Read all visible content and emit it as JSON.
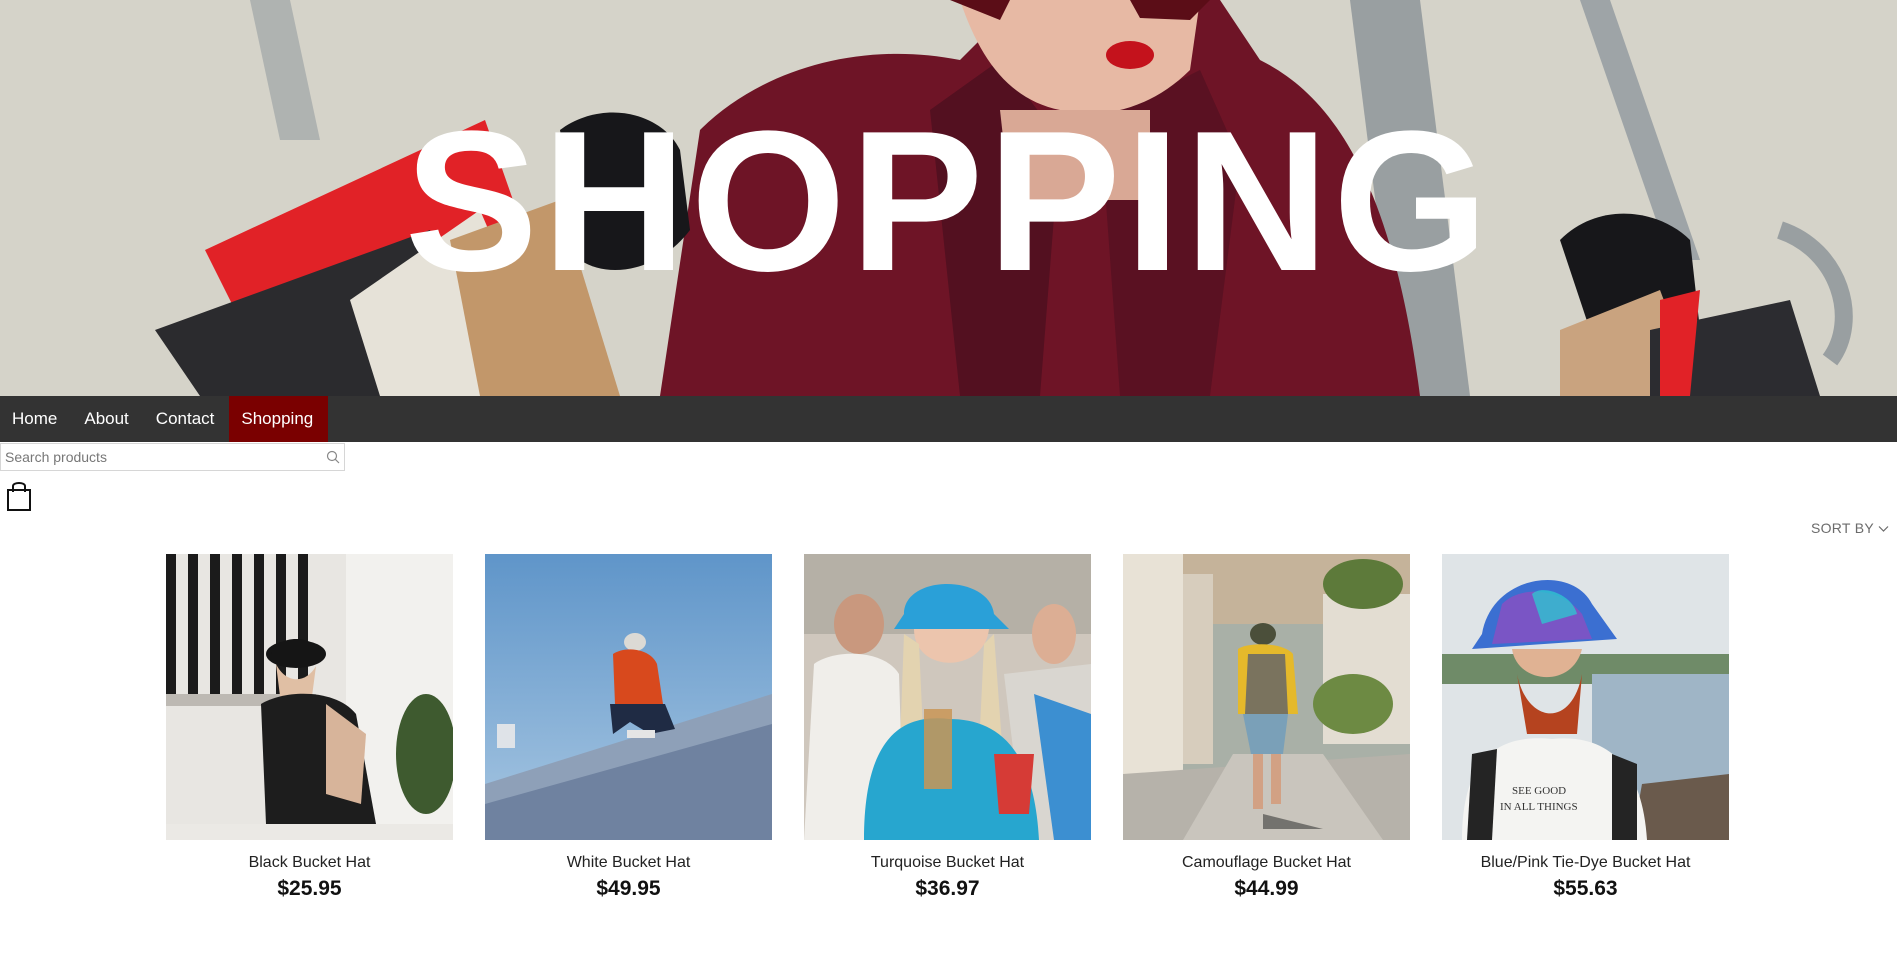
{
  "hero": {
    "title": "SHOPPING"
  },
  "nav": {
    "items": [
      {
        "label": "Home"
      },
      {
        "label": "About"
      },
      {
        "label": "Contact"
      },
      {
        "label": "Shopping",
        "active": true
      }
    ],
    "active_color": "#7a0000",
    "bar_color": "#333333"
  },
  "search": {
    "placeholder": "Search products",
    "value": "",
    "icon": "search-icon"
  },
  "cart": {
    "icon": "shopping-bag-icon"
  },
  "sort": {
    "label": "SORT BY",
    "icon": "chevron-down-icon"
  },
  "products": [
    {
      "name": "Black Bucket Hat",
      "price": "$25.95"
    },
    {
      "name": "White Bucket Hat",
      "price": "$49.95"
    },
    {
      "name": "Turquoise Bucket Hat",
      "price": "$36.97"
    },
    {
      "name": "Camouflage Bucket Hat",
      "price": "$44.99"
    },
    {
      "name": "Blue/Pink Tie-Dye Bucket Hat",
      "price": "$55.63"
    }
  ]
}
